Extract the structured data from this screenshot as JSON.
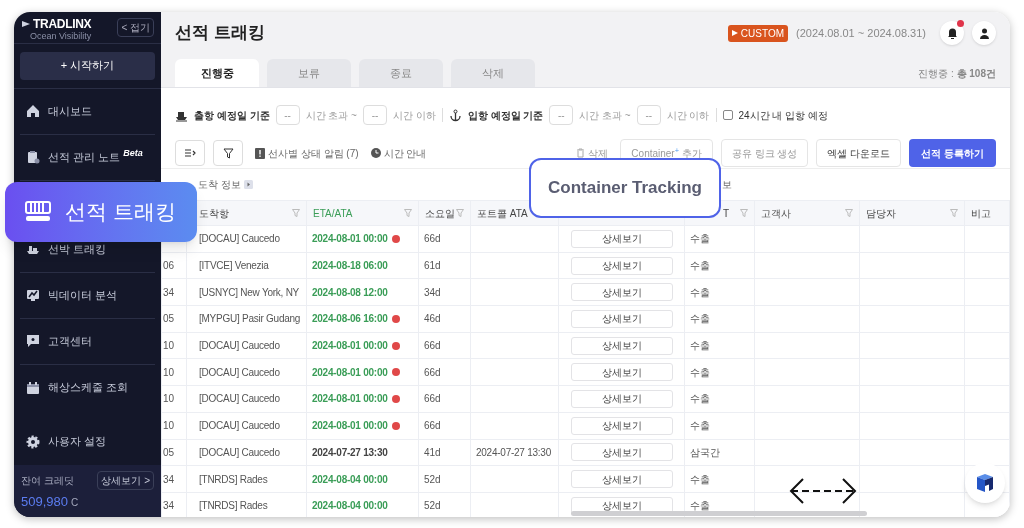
{
  "brand": {
    "logo": "TRADLINX",
    "tagline": "Ocean Visibility",
    "collapse": "< 접기"
  },
  "start_button": "+ 시작하기",
  "sidebar": {
    "items": [
      {
        "label": "대시보드"
      },
      {
        "label": "선적 관리 노트 $^{Beta}$"
      },
      {
        "label": "선박 트래킹"
      },
      {
        "label": "빅데이터 분석"
      },
      {
        "label": "고객센터"
      },
      {
        "label": "해상스케줄 조회"
      },
      {
        "label": "사용자 설정"
      }
    ]
  },
  "credits": {
    "label": "잔여 크레딧",
    "button": "상세보기 >",
    "value": "509,980",
    "unit": "C"
  },
  "header": {
    "title": "선적 트래킹",
    "plan": "CUSTOM",
    "period": "(2024.08.01 ~ 2024.08.31)",
    "unread": true
  },
  "tabs": [
    {
      "label": "진행중",
      "selected": true
    },
    {
      "label": "보류",
      "selected": false
    },
    {
      "label": "종료",
      "selected": false
    },
    {
      "label": "삭제",
      "selected": false
    }
  ],
  "count": "진행중 : **총 108건**",
  "filters": [
    {
      "label": "출항 예정일 기준",
      "from": "--",
      "from_suffix": "시간 초과 ~",
      "to": "--",
      "to_suffix": "시간 이하"
    },
    {
      "label": "입항 예정일 기준",
      "from": "--",
      "from_suffix": "시간 초과 ~",
      "to": "--",
      "to_suffix": "시간 이하"
    }
  ],
  "arrival_24h": {
    "label": "24시간 내 입항 예정",
    "checked": false
  },
  "toolbar": {
    "alerts": "선사별 상태 알림 (7)",
    "time_guide": "시간 안내",
    "buttons": [
      {
        "label": "삭제",
        "kind": "ghost",
        "disabled": true
      },
      {
        "label": "Container$^{+}$ 추가",
        "kind": "outline",
        "disabled": true
      },
      {
        "label": "공유 링크 생성",
        "kind": "outline",
        "disabled": true
      },
      {
        "label": "엑셀 다운로드",
        "kind": "outline",
        "disabled": false
      },
      {
        "label": "선적 등록하기",
        "kind": "primary",
        "disabled": false
      }
    ]
  },
  "group_headers": [
    "도착 정보",
    "보"
  ],
  "table": {
    "columns": [
      {},
      {
        "label": "도착항",
        "filterable": true,
        "accent": false
      },
      {
        "label": "ETA/ATA",
        "filterable": true,
        "accent": true
      },
      {
        "label": "소요일",
        "filterable": true,
        "accent": false
      },
      {
        "label": "포트콜 ATA",
        "filterable": false,
        "accent": false
      },
      {},
      {
        "label": "T",
        "filterable": true,
        "accent": false
      },
      {
        "label": "고객사",
        "filterable": true,
        "accent": false
      },
      {
        "label": "담당자",
        "filterable": true,
        "accent": false
      },
      {
        "label": "비고",
        "filterable": false,
        "accent": false
      }
    ],
    "rows": [
      {
        "port": "[DOCAU] Caucedo",
        "eta": "2024-08-01 00:00",
        "actual": false,
        "delayed": true,
        "days": "66d",
        "detail": "상세보기",
        "type": "수출"
      },
      {
        "code": "06",
        "port": "[ITVCE] Venezia",
        "eta": "2024-08-18 06:00",
        "actual": false,
        "delayed": false,
        "days": "61d",
        "detail": "상세보기",
        "type": "수출"
      },
      {
        "code": "34",
        "port": "[USNYC] New York, NY",
        "eta": "2024-08-08 12:00",
        "actual": false,
        "delayed": false,
        "days": "34d",
        "detail": "상세보기",
        "type": "수출"
      },
      {
        "code": "05",
        "port": "[MYPGU] Pasir Gudang",
        "eta": "2024-08-06 16:00",
        "actual": false,
        "delayed": true,
        "days": "46d",
        "detail": "상세보기",
        "type": "수출"
      },
      {
        "code": "10",
        "port": "[DOCAU] Caucedo",
        "eta": "2024-08-01 00:00",
        "actual": false,
        "delayed": true,
        "days": "66d",
        "detail": "상세보기",
        "type": "수출"
      },
      {
        "code": "10",
        "port": "[DOCAU] Caucedo",
        "eta": "2024-08-01 00:00",
        "actual": false,
        "delayed": true,
        "days": "66d",
        "detail": "상세보기",
        "type": "수출"
      },
      {
        "code": "10",
        "port": "[DOCAU] Caucedo",
        "eta": "2024-08-01 00:00",
        "actual": false,
        "delayed": true,
        "days": "66d",
        "detail": "상세보기",
        "type": "수출"
      },
      {
        "code": "10",
        "port": "[DOCAU] Caucedo",
        "eta": "2024-08-01 00:00",
        "actual": false,
        "delayed": true,
        "days": "66d",
        "detail": "상세보기",
        "type": "수출"
      },
      {
        "code": "05",
        "port": "[DOCAU] Caucedo",
        "eta": "2024-07-27 13:30",
        "actual": true,
        "delayed": false,
        "days": "41d",
        "portcall": "2024-07-27 13:30",
        "detail": "상세보기",
        "type": "삼국간"
      },
      {
        "code": "34",
        "port": "[TNRDS] Rades",
        "eta": "2024-08-04 00:00",
        "actual": false,
        "delayed": false,
        "days": "52d",
        "detail": "상세보기",
        "type": "수출"
      },
      {
        "code": "34",
        "port": "[TNRDS] Rades",
        "eta": "2024-08-04 00:00",
        "actual": false,
        "delayed": false,
        "days": "52d",
        "detail": "상세보기",
        "type": "수출"
      }
    ]
  },
  "callouts": {
    "feature": "선적 트래킹",
    "caption": "Container Tracking"
  }
}
